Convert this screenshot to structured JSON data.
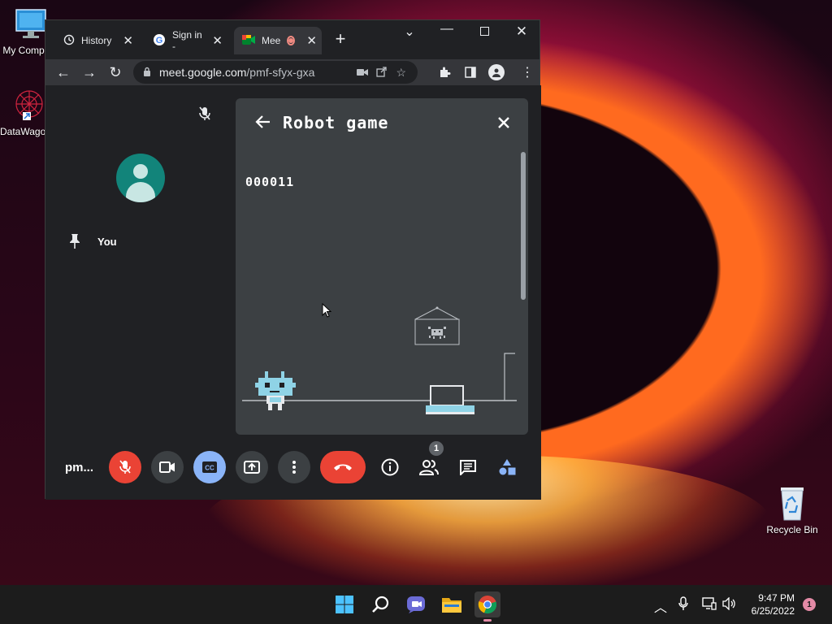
{
  "desktop": {
    "icons": [
      {
        "label": "My Comp"
      },
      {
        "label": "DataWago"
      },
      {
        "label": "Recycle Bin"
      }
    ]
  },
  "browser": {
    "tabs": [
      {
        "label": "History",
        "icon": "history-icon"
      },
      {
        "label": "Sign in -",
        "icon": "google-icon"
      },
      {
        "label": "Mee",
        "icon": "meet-icon"
      }
    ],
    "url_host": "meet.google.com",
    "url_path": "/pmf-sfyx-gxa"
  },
  "meet": {
    "participant_name": "You",
    "meeting_code": "pm...",
    "participants_badge": "1",
    "panel": {
      "title": "Robot game",
      "score": "000011"
    }
  },
  "taskbar": {
    "time": "9:47 PM",
    "date": "6/25/2022",
    "notification_count": "1"
  },
  "colors": {
    "meet_bg": "#202124",
    "panel_bg": "#3c4043",
    "end_call_red": "#ea4335",
    "cc_blue": "#8ab4f8",
    "avatar_teal": "#12847a"
  }
}
